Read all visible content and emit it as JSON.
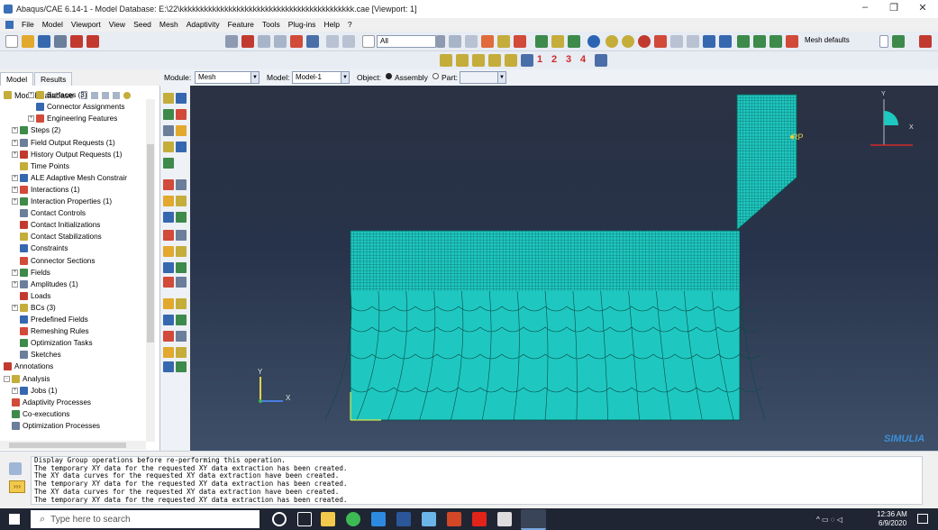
{
  "window": {
    "title": "Abaqus/CAE 6.14-1 - Model Database: E:\\22\\kkkkkkkkkkkkkkkkkkkkkkkkkkkkkkkkkkkkkkkkkkk.cae [Viewport: 1]",
    "minimize": "–",
    "maximize": "❐",
    "close": "✕"
  },
  "menu": [
    "File",
    "Model",
    "Viewport",
    "View",
    "Seed",
    "Mesh",
    "Adaptivity",
    "Feature",
    "Tools",
    "Plug-ins",
    "Help",
    "?"
  ],
  "toolbar": {
    "selection_filter": "All",
    "mesh_defaults": "Mesh defaults",
    "numbers": [
      "1",
      "2",
      "3",
      "4"
    ]
  },
  "context": {
    "module_label": "Module:",
    "module_value": "Mesh",
    "model_label": "Model:",
    "model_value": "Model-1",
    "object_label": "Object:",
    "assembly": "Assembly",
    "part": "Part:"
  },
  "tabs": [
    "Model",
    "Results"
  ],
  "tree_header": "Model Database",
  "tree": [
    {
      "label": "Surfaces (3)",
      "indent": 3,
      "exp": "+"
    },
    {
      "label": "Connector Assignments",
      "indent": 4,
      "exp": ""
    },
    {
      "label": "Engineering Features",
      "indent": 3,
      "exp": "+"
    },
    {
      "label": "Steps (2)",
      "indent": 1,
      "exp": "+"
    },
    {
      "label": "Field Output Requests (1)",
      "indent": 1,
      "exp": "+"
    },
    {
      "label": "History Output Requests (1)",
      "indent": 1,
      "exp": "+"
    },
    {
      "label": "Time Points",
      "indent": 2,
      "exp": ""
    },
    {
      "label": "ALE Adaptive Mesh Constrair",
      "indent": 1,
      "exp": "+"
    },
    {
      "label": "Interactions (1)",
      "indent": 1,
      "exp": "+"
    },
    {
      "label": "Interaction Properties (1)",
      "indent": 1,
      "exp": "+"
    },
    {
      "label": "Contact Controls",
      "indent": 2,
      "exp": ""
    },
    {
      "label": "Contact Initializations",
      "indent": 2,
      "exp": ""
    },
    {
      "label": "Contact Stabilizations",
      "indent": 2,
      "exp": ""
    },
    {
      "label": "Constraints",
      "indent": 2,
      "exp": ""
    },
    {
      "label": "Connector Sections",
      "indent": 2,
      "exp": ""
    },
    {
      "label": "Fields",
      "indent": 1,
      "exp": "+"
    },
    {
      "label": "Amplitudes (1)",
      "indent": 1,
      "exp": "+"
    },
    {
      "label": "Loads",
      "indent": 2,
      "exp": ""
    },
    {
      "label": "BCs (3)",
      "indent": 1,
      "exp": "+"
    },
    {
      "label": "Predefined Fields",
      "indent": 2,
      "exp": ""
    },
    {
      "label": "Remeshing Rules",
      "indent": 2,
      "exp": ""
    },
    {
      "label": "Optimization Tasks",
      "indent": 2,
      "exp": ""
    },
    {
      "label": "Sketches",
      "indent": 2,
      "exp": ""
    },
    {
      "label": "Annotations",
      "indent": 0,
      "exp": ""
    },
    {
      "label": "Analysis",
      "indent": 0,
      "exp": "-"
    },
    {
      "label": "Jobs (1)",
      "indent": 1,
      "exp": "+"
    },
    {
      "label": "Adaptivity Processes",
      "indent": 1,
      "exp": ""
    },
    {
      "label": "Co-executions",
      "indent": 1,
      "exp": ""
    },
    {
      "label": "Optimization Processes",
      "indent": 1,
      "exp": ""
    }
  ],
  "viewport": {
    "rp_label": "RP",
    "triad_y": "Y",
    "triad_x": "X",
    "mini_y": "Y",
    "mini_x": "X",
    "brand": "SIMULIA"
  },
  "messages": [
    "Display Group operations before re-performing this operation.",
    "The temporary XY data for the requested XY data extraction has been created.",
    "The XY data curves for the requested XY data extraction have been created.",
    "The temporary XY data for the requested XY data extraction has been created.",
    "The XY data curves for the requested XY data extraction have been created.",
    "The temporary XY data for the requested XY data extraction has been created."
  ],
  "taskbar": {
    "search_placeholder": "Type here to search",
    "time": "12:36 AM",
    "date": "6/9/2020"
  },
  "colors": {
    "mesh": "#1ec8c0",
    "viewport_top": "#2a3243",
    "taskbar": "#1f2533"
  }
}
